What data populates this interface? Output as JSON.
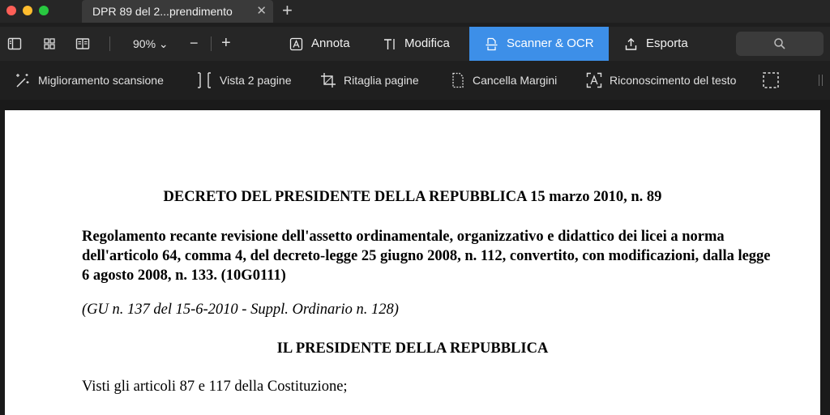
{
  "tab": {
    "title": "DPR 89 del 2...prendimento",
    "close": "✕"
  },
  "new_tab_symbol": "+",
  "toolbar": {
    "icons": [
      "sidebar-icon",
      "grid-icon",
      "reader-icon"
    ],
    "zoom": "90% ⌄",
    "zoom_out": "−",
    "zoom_in": "+",
    "modes": [
      {
        "label": "Annota",
        "icon": "annotate-icon"
      },
      {
        "label": "Modifica",
        "icon": "edit-text-icon"
      },
      {
        "label": "Scanner & OCR",
        "icon": "scanner-icon",
        "active": true
      },
      {
        "label": "Esporta",
        "icon": "export-icon"
      }
    ],
    "search_icon": "search-icon"
  },
  "subtoolbar": {
    "items": [
      {
        "label": "Miglioramento scansione",
        "icon": "magic-wand-icon"
      },
      {
        "label": "Vista 2 pagine",
        "icon": "two-page-icon"
      },
      {
        "label": "Ritaglia pagine",
        "icon": "crop-icon"
      },
      {
        "label": "Cancella Margini",
        "icon": "clear-margins-icon"
      },
      {
        "label": "Riconoscimento del testo",
        "icon": "ocr-icon"
      }
    ],
    "extra_icon": "selection-icon"
  },
  "document": {
    "title": "DECRETO DEL PRESIDENTE DELLA REPUBBLICA 15 marzo 2010, n. 89",
    "subject": "Regolamento recante revisione dell'assetto ordinamentale, organizzativo e didattico dei licei a norma dell'articolo 64, comma 4, del decreto-legge 25 giugno 2008, n. 112, convertito, con modificazioni, dalla legge 6 agosto 2008, n. 133. (10G0111)",
    "gazette": "(GU n. 137 del 15-6-2010 - Suppl. Ordinario n. 128)",
    "president_heading": "IL PRESIDENTE DELLA REPUBBLICA",
    "visti": "Visti gli articoli 87 e 117 della Costituzione;"
  },
  "colors": {
    "accent": "#3d8fe8",
    "toolbar_bg": "#262626",
    "page_bg": "#ffffff"
  }
}
